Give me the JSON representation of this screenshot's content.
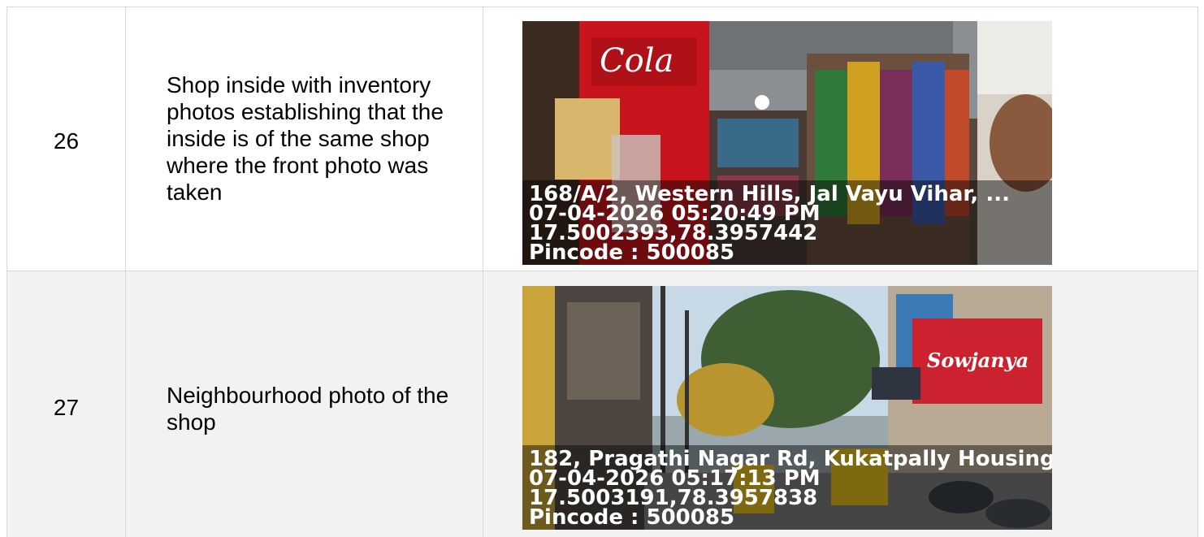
{
  "rows": [
    {
      "number": "26",
      "description": "Shop inside with inventory photos establishing that the inside is of the same shop where the front photo was taken",
      "photo": {
        "subject": "shop-interior",
        "stamp": {
          "address": "168/A/2, Western Hills, Jal Vayu Vihar, ...",
          "datetime": "07-04-2026 05:20:49 PM",
          "coords": "17.5002393,78.3957442",
          "pincode": "Pincode : 500085"
        }
      }
    },
    {
      "number": "27",
      "description": "Neighbourhood photo of the shop",
      "photo": {
        "subject": "street-view",
        "stamp": {
          "address": "182, Pragathi Nagar Rd, Kukatpally Housing",
          "datetime": "07-04-2026 05:17:13 PM",
          "coords": "17.5003191,78.3957838",
          "pincode": "Pincode : 500085"
        }
      }
    }
  ],
  "colors": {
    "border": "#d9d9d9",
    "row_alt_bg": "#f2f2f2",
    "stamp_text": "#ffffff"
  }
}
